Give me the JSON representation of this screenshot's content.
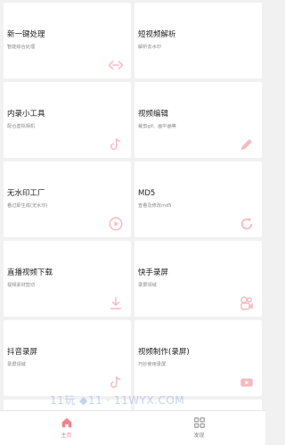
{
  "accent": "#f0828d",
  "cards": [
    {
      "title": "新一键处理",
      "subtitle": "智能综合处理",
      "icon": "code-arrows-icon"
    },
    {
      "title": "短视频解析",
      "subtitle": "解析去水印",
      "icon": null
    },
    {
      "title": "内录小工具",
      "subtitle": "配合虚拟相机",
      "icon": "tiktok-note-icon"
    },
    {
      "title": "视频编辑",
      "subtitle": "裁剪gif、画中画等",
      "icon": "pencil-icon"
    },
    {
      "title": "无水印工厂",
      "subtitle": "看过即生成(无水印)",
      "icon": "play-circle-icon"
    },
    {
      "title": "MD5",
      "subtitle": "查看及修改md5",
      "icon": "refresh-icon"
    },
    {
      "title": "直播视频下载",
      "subtitle": "视频素材剪切",
      "icon": "download-icon"
    },
    {
      "title": "快手录屏",
      "subtitle": "录屏领域",
      "icon": "kuaishou-camera-icon"
    },
    {
      "title": "抖音录屏",
      "subtitle": "录屏领域",
      "icon": "tiktok-note-icon"
    },
    {
      "title": "视频制作(录屏)",
      "subtitle": "巧妙使用录屏",
      "icon": "video-play-icon"
    }
  ],
  "watermark": "11玩  ◆11  · 11WYX.COM",
  "tabs": [
    {
      "label": "主页",
      "icon": "home-icon",
      "active": true
    },
    {
      "label": "发现",
      "icon": "discover-grid-icon",
      "active": false
    }
  ]
}
